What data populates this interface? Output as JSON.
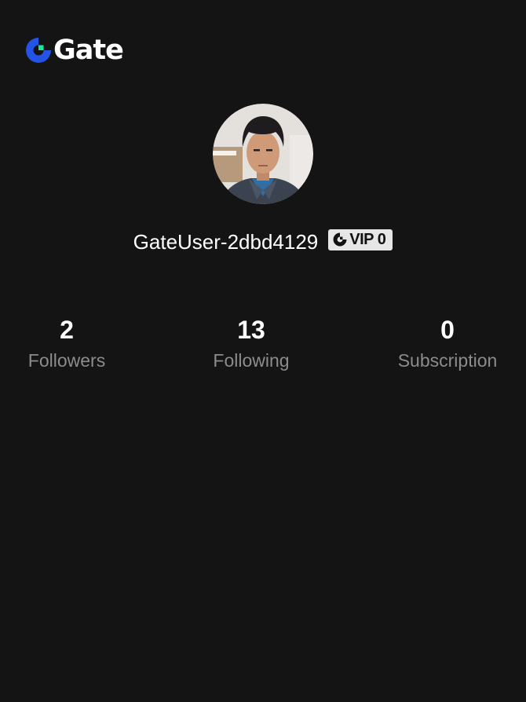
{
  "brand": {
    "name": "Gate",
    "logo_icon": "gate-logo-icon",
    "accent_color": "#2354e6",
    "accent_secondary": "#17e6a1"
  },
  "profile": {
    "avatar_icon": "avatar-photo",
    "username": "GateUser-2dbd4129",
    "vip": {
      "icon": "gate-logo-icon",
      "label": "VIP 0"
    }
  },
  "stats": {
    "followers": {
      "value": "2",
      "label": "Followers"
    },
    "following": {
      "value": "13",
      "label": "Following"
    },
    "subscription": {
      "value": "0",
      "label": "Subscription"
    }
  }
}
